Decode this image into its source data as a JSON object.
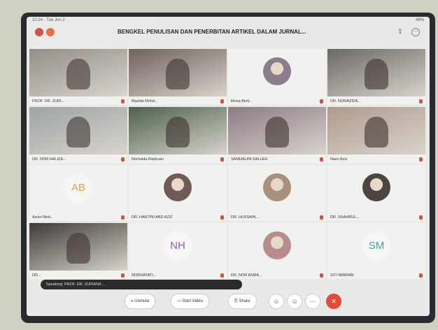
{
  "status": {
    "left": "10:24 · Tue Jun 2",
    "right": "48%"
  },
  "meeting": {
    "title": "BENGKEL PENULISAN DAN PENERBITAN ARTIKEL DALAM JURNAL..."
  },
  "participants": [
    {
      "name": "PROF. DR. ZURI...",
      "kind": "video",
      "bg": "#8e8a82"
    },
    {
      "name": "Mazida Mohd...",
      "kind": "video",
      "bg": "#6d5e58"
    },
    {
      "name": "Mona Binti...",
      "kind": "photo",
      "bg": "#8a7e8c"
    },
    {
      "name": "DR. NORAZIDA...",
      "kind": "video",
      "bg": "#6a6864"
    },
    {
      "name": "DR. NOR HALIZA...",
      "kind": "video",
      "bg": "#9aa0a2"
    },
    {
      "name": "Norhaida Radzuan",
      "kind": "video",
      "bg": "#4b5f49"
    },
    {
      "name": "SAMHALINI SALLEH",
      "kind": "video",
      "bg": "#8c7a84"
    },
    {
      "name": "Nazri Aziz",
      "kind": "video",
      "bg": "#b09a8e"
    },
    {
      "name": "Azian Binti...",
      "kind": "initials",
      "initials": "AB",
      "color": "#e8a24a"
    },
    {
      "name": "DR. HARTINI ABD AZIZ",
      "kind": "photo",
      "bg": "#6f5a58"
    },
    {
      "name": "DR. HUSSAIN...",
      "kind": "photo",
      "bg": "#a8907a"
    },
    {
      "name": "DR. SHAHRUL...",
      "kind": "photo",
      "bg": "#4d4440"
    },
    {
      "name": "DR...",
      "kind": "video",
      "bg": "#3a3632"
    },
    {
      "name": "NORHAYATI...",
      "kind": "initials",
      "initials": "NH",
      "color": "#8a5fc0"
    },
    {
      "name": "DR. NOR ASMA...",
      "kind": "photo",
      "bg": "#b68c8c"
    },
    {
      "name": "SITI MARIAM",
      "kind": "initials",
      "initials": "SM",
      "color": "#4aa59a"
    }
  ],
  "toast": {
    "text": "Speaking: PROF. DR. ZURIANA ..."
  },
  "controls": {
    "unmute": "Unmute",
    "start_video": "Start Video",
    "share": "Share"
  },
  "colors": {
    "leave": "#e04b3c",
    "mic_muted": "#e04b3c"
  }
}
